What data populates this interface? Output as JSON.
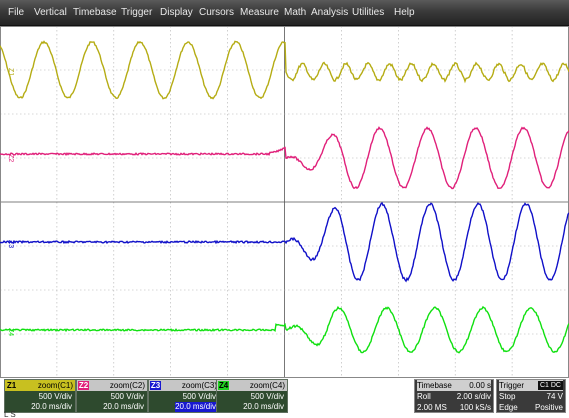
{
  "menu": [
    "File",
    "Vertical",
    "Timebase",
    "Trigger",
    "Display",
    "Cursors",
    "Measure",
    "Math",
    "Analysis",
    "Utilities",
    "Help"
  ],
  "traces": [
    {
      "tag": "Z1",
      "color": "#b5ac14"
    },
    {
      "tag": "Z2",
      "color": "#e0207a"
    },
    {
      "tag": "Z3",
      "color": "#1010c8"
    },
    {
      "tag": "Z4",
      "color": "#10e010"
    }
  ],
  "channels": [
    {
      "tag": "Z1",
      "zoom": "zoom(C1)",
      "vdiv": "500 V/div",
      "tdiv": "20.0 ms/div",
      "color": "#c8c020"
    },
    {
      "tag": "Z2",
      "zoom": "zoom(C2)",
      "vdiv": "500 V/div",
      "tdiv": "20.0 ms/div",
      "color": "#e0207a"
    },
    {
      "tag": "Z3",
      "zoom": "zoom(C3)",
      "vdiv": "500 V/div",
      "tdiv": "20.0 ms/div",
      "color": "#1818d0"
    },
    {
      "tag": "Z4",
      "zoom": "zoom(C4)",
      "vdiv": "500 V/div",
      "tdiv": "20.0 ms/div",
      "color": "#20d020"
    }
  ],
  "timebase": {
    "title": "Timebase",
    "delay": "0.00 s",
    "mode": "Roll",
    "tdiv": "2.00 s/div",
    "points": "2.00 MS",
    "rate": "100 kS/s"
  },
  "trigger": {
    "title": "Trigger",
    "mode": "C1 DC",
    "state": "Stop",
    "level": "74 V",
    "type": "Edge",
    "slope": "Positive"
  },
  "corner_glyph": "L S"
}
